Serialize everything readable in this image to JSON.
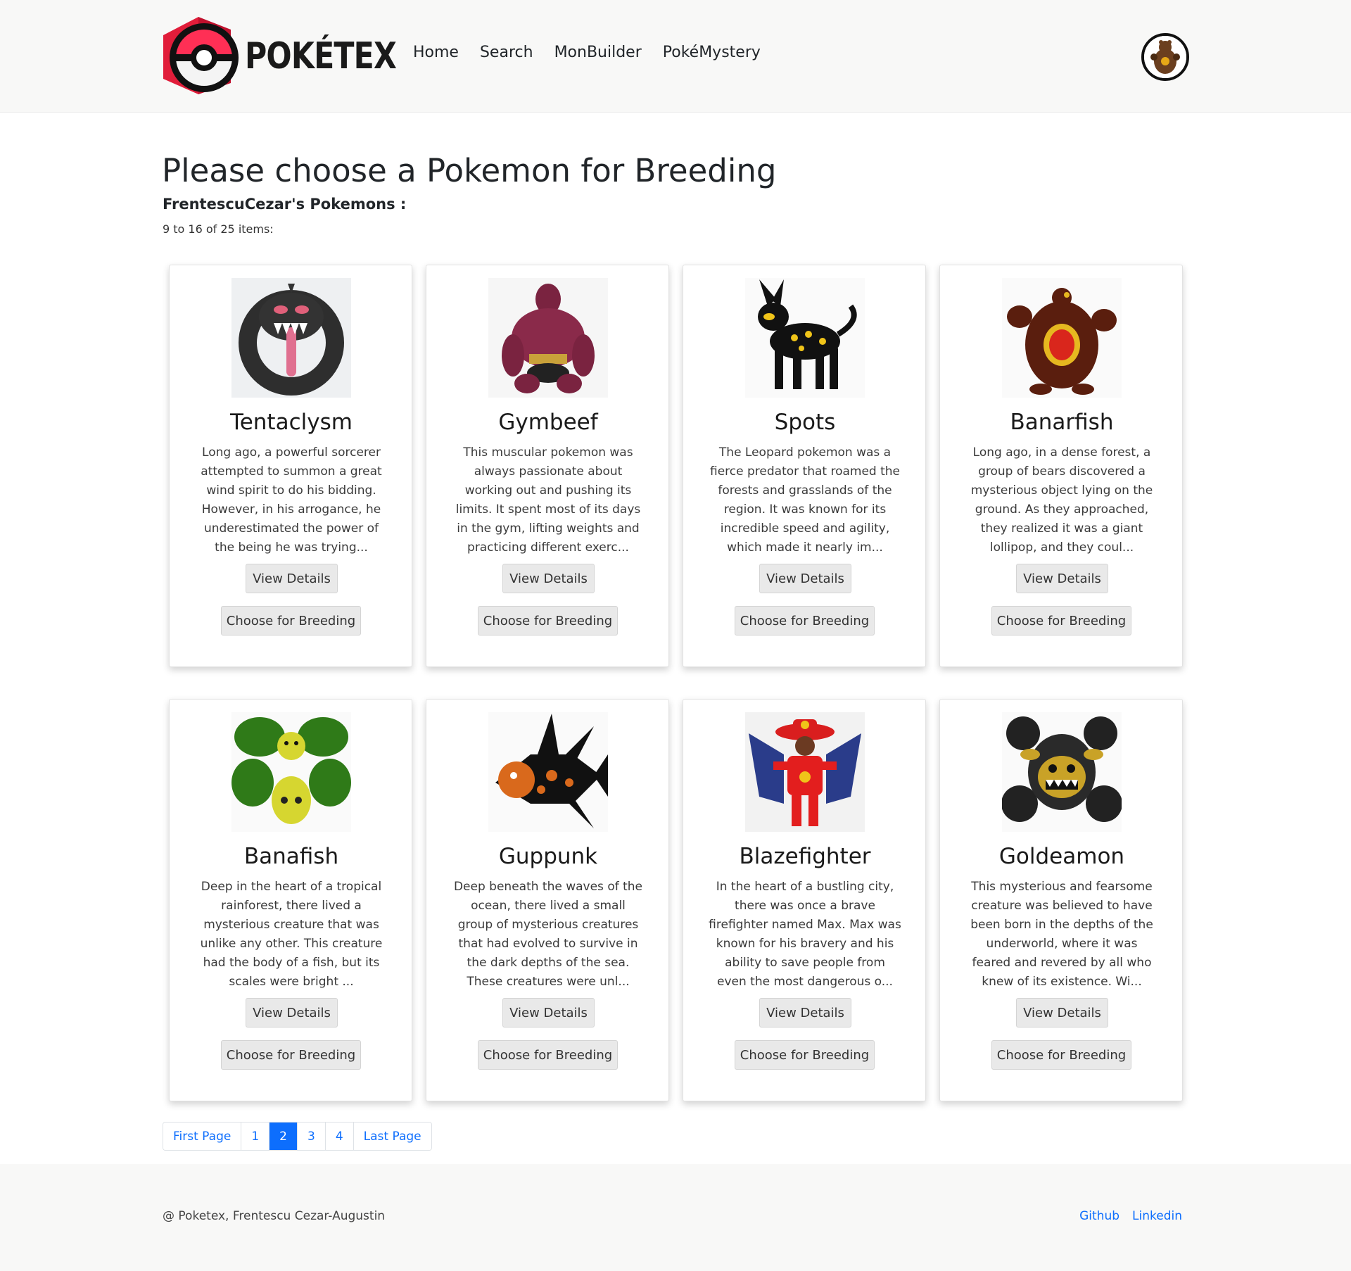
{
  "header": {
    "brand": "POKÉTEX",
    "nav": [
      "Home",
      "Search",
      "MonBuilder",
      "PokéMystery"
    ]
  },
  "main": {
    "title": "Please choose a Pokemon for Breeding",
    "subtitle": "FrentescuCezar's Pokemons :",
    "count": "9 to 16 of 25 items:"
  },
  "cards": [
    {
      "name": "Tentaclysm",
      "desc": "Long ago, a powerful sorcerer attempted to summon a great wind spirit to do his bidding. However, in his arrogance, he underestimated the power of the being he was trying...",
      "view": "View Details",
      "breed": "Choose for Breeding"
    },
    {
      "name": "Gymbeef",
      "desc": "This muscular pokemon was always passionate about working out and pushing its limits. It spent most of its days in the gym, lifting weights and practicing different exerc...",
      "view": "View Details",
      "breed": "Choose for Breeding"
    },
    {
      "name": "Spots",
      "desc": "The Leopard pokemon was a fierce predator that roamed the forests and grasslands of the region. It was known for its incredible speed and agility, which made it nearly im...",
      "view": "View Details",
      "breed": "Choose for Breeding"
    },
    {
      "name": "Banarfish",
      "desc": "Long ago, in a dense forest, a group of bears discovered a mysterious object lying on the ground. As they approached, they realized it was a giant lollipop, and they coul...",
      "view": "View Details",
      "breed": "Choose for Breeding"
    },
    {
      "name": "Banafish",
      "desc": "Deep in the heart of a tropical rainforest, there lived a mysterious creature that was unlike any other. This creature had the body of a fish, but its scales were bright ...",
      "view": "View Details",
      "breed": "Choose for Breeding"
    },
    {
      "name": "Guppunk",
      "desc": "Deep beneath the waves of the ocean, there lived a small group of mysterious creatures that had evolved to survive in the dark depths of the sea. These creatures were unl...",
      "view": "View Details",
      "breed": "Choose for Breeding"
    },
    {
      "name": "Blazefighter",
      "desc": "In the heart of a bustling city, there was once a brave firefighter named Max. Max was known for his bravery and his ability to save people from even the most dangerous o...",
      "view": "View Details",
      "breed": "Choose for Breeding"
    },
    {
      "name": "Goldeamon",
      "desc": "This mysterious and fearsome creature was believed to have been born in the depths of the underworld, where it was feared and revered by all who knew of its existence. Wi...",
      "view": "View Details",
      "breed": "Choose for Breeding"
    }
  ],
  "pagination": {
    "first": "First Page",
    "pages": [
      "1",
      "2",
      "3",
      "4"
    ],
    "active": "2",
    "last": "Last Page"
  },
  "footer": {
    "copyright": "@ Poketex, Frentescu Cezar-Augustin",
    "links": [
      "Github",
      "Linkedin"
    ]
  }
}
